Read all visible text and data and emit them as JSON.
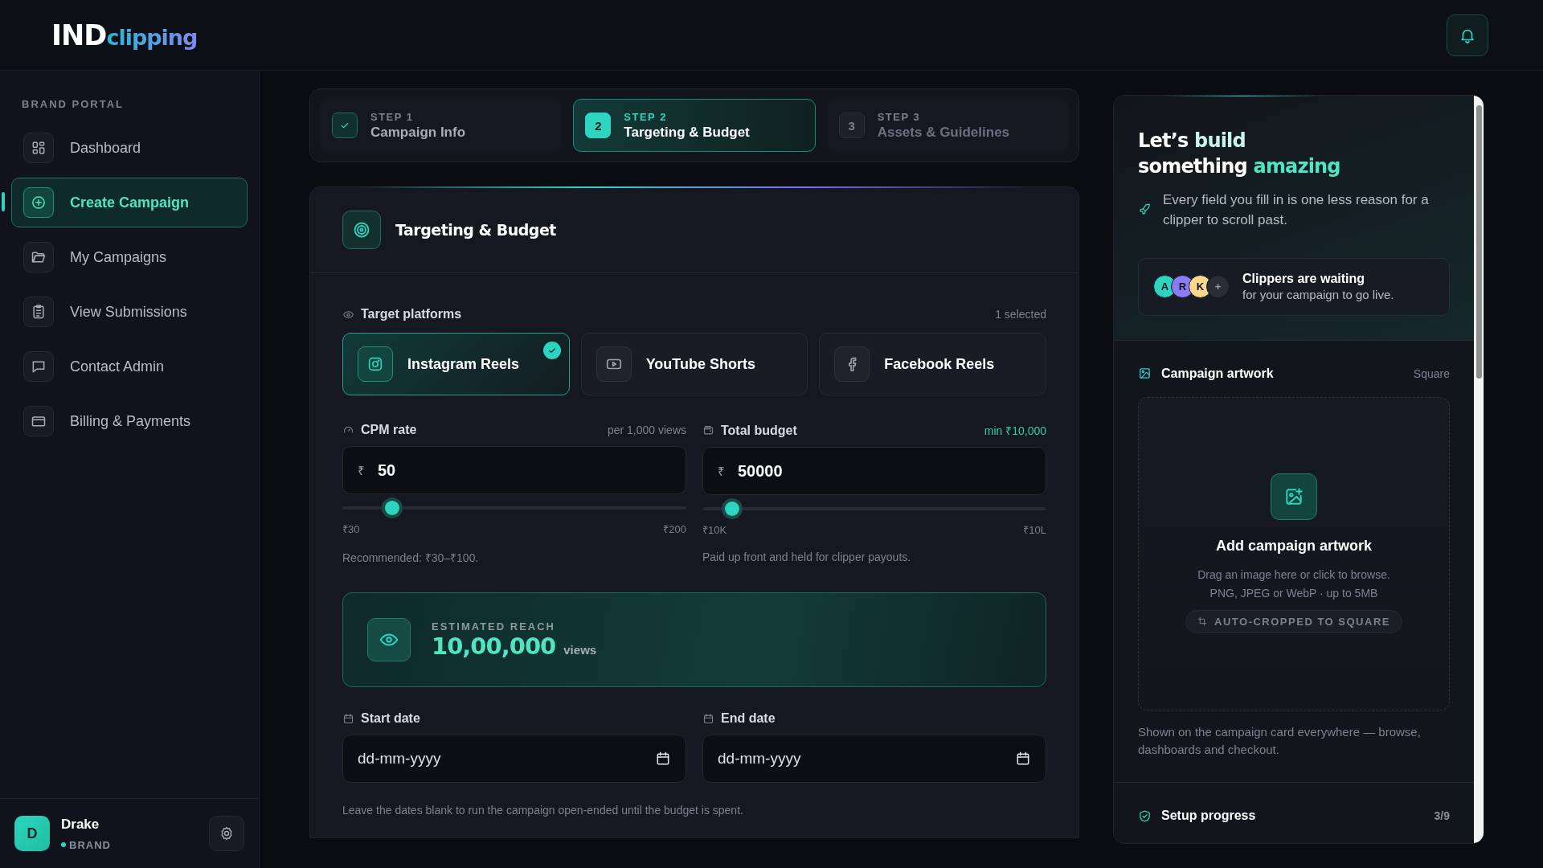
{
  "header": {
    "logo": {
      "primary": "IND",
      "secondary": "clipping"
    }
  },
  "sidebar": {
    "section_label": "BRAND PORTAL",
    "items": [
      {
        "label": "Dashboard",
        "selected": false
      },
      {
        "label": "Create Campaign",
        "selected": true
      },
      {
        "label": "My Campaigns",
        "selected": false
      },
      {
        "label": "View Submissions",
        "selected": false
      },
      {
        "label": "Contact Admin",
        "selected": false
      },
      {
        "label": "Billing & Payments",
        "selected": false
      }
    ],
    "user": {
      "initial": "D",
      "name": "Drake",
      "role": "BRAND"
    }
  },
  "steps": [
    {
      "label": "STEP 1",
      "title": "Campaign Info",
      "done": true,
      "selected": false
    },
    {
      "label": "STEP 2",
      "title": "Targeting & Budget",
      "badge": "2",
      "done": false,
      "selected": true
    },
    {
      "label": "STEP 3",
      "title": "Assets & Guidelines",
      "badge": "3",
      "done": false,
      "selected": false
    }
  ],
  "form": {
    "title": "Targeting & Budget",
    "platforms_label": "Target platforms",
    "platforms_count": "1 selected",
    "platforms": [
      {
        "label": "Instagram Reels",
        "selected": true
      },
      {
        "label": "YouTube Shorts",
        "selected": false
      },
      {
        "label": "Facebook Reels",
        "selected": false
      }
    ],
    "amounts": [
      {
        "label": "CPM rate",
        "note": "per 1,000 views",
        "currency": "₹",
        "value": "50",
        "level": 0.12,
        "min": "₹30",
        "max": "₹200",
        "hint": "Recommended: ₹30–₹100."
      },
      {
        "label": "Total budget",
        "note": "min ₹10,000",
        "currency": "₹",
        "value": "50000",
        "level": 0.06,
        "min": "₹10K",
        "max": "₹10L",
        "hint": "Paid up front and held for clipper payouts."
      }
    ],
    "reach": {
      "label": "ESTIMATED REACH",
      "value": "10,00,000",
      "unit": "views"
    },
    "dates": [
      {
        "label": "Start date",
        "placeholder": "dd-mm-yyyy"
      },
      {
        "label": "End date",
        "placeholder": "dd-mm-yyyy"
      }
    ],
    "dates_hint": "Leave the dates blank to run the campaign open-ended until the budget is spent."
  },
  "panel": {
    "headline": [
      [
        {
          "text": "Let’s",
          "color": "#ffffff"
        },
        {
          "text": "build",
          "color": "#c9f5ea"
        }
      ],
      [
        {
          "text": "something",
          "color": "#ffffff"
        },
        {
          "text": "amazing",
          "color": "#4fe5c4"
        }
      ]
    ],
    "tagline": "Every field you fill in is one less reason for a clipper to scroll past.",
    "avatars": [
      {
        "text": "A",
        "color": "#2dd4bf"
      },
      {
        "text": "R",
        "color": "#8b7cf6"
      },
      {
        "text": "K",
        "color": "#fcd98a"
      },
      {
        "text": "+",
        "color": "#2a2d38"
      }
    ],
    "waiting_title": "Clippers are waiting",
    "waiting_text": "for your campaign to go live.",
    "artwork_label": "Campaign artwork",
    "artwork_shape": "Square",
    "upload_title": "Add campaign artwork",
    "upload_lines": [
      "Drag an image here or click to browse.",
      "PNG, JPEG or WebP · up to 5MB"
    ],
    "upload_tag": "AUTO-CROPPED TO SQUARE",
    "artwork_caption": "Shown on the campaign card everywhere — browse, dashboards and checkout.",
    "progress_label": "Setup progress",
    "progress_count": "3/9"
  }
}
